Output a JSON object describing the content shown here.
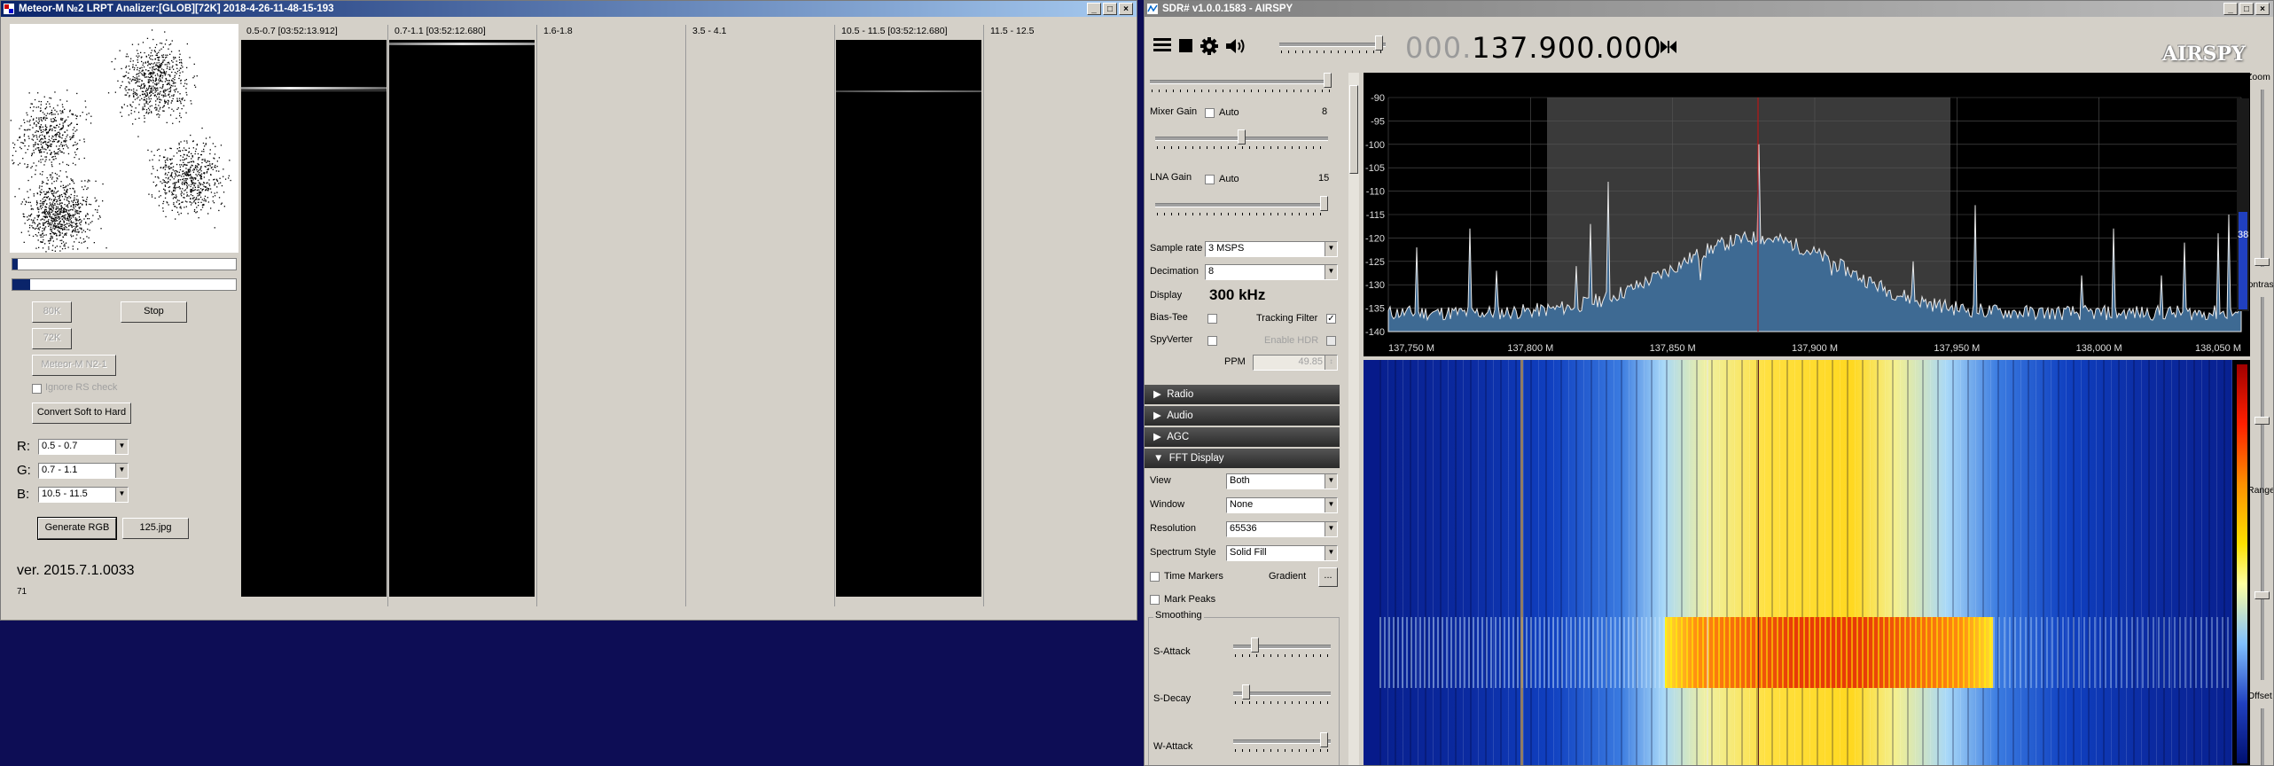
{
  "meteor": {
    "title": "Meteor-M №2 LRPT Analizer:[GLOB][72K] 2018-4-26-11-48-15-193",
    "channel_headers": [
      "0.5-0.7 [03:52:13.912]",
      "0.7-1.1 [03:52:12.680]",
      "1.6-1.8",
      "3.5 - 4.1",
      "10.5 - 11.5 [03:52:12.680]",
      "11.5 - 12.5"
    ],
    "buttons": {
      "btn_80k": "80K",
      "stop": "Stop",
      "btn_72k": "72K",
      "meteor_n21": "Meteor-M N2-1",
      "convert": "Convert Soft to Hard",
      "generate_rgb": "Generate RGB",
      "jpg": "125.jpg"
    },
    "ignore_rs": "Ignore RS check",
    "rgb": {
      "r_label": "R:",
      "r_value": "0.5 - 0.7",
      "g_label": "G:",
      "g_value": "0.7 - 1.1",
      "b_label": "B:",
      "b_value": "10.5 - 11.5"
    },
    "version": "ver. 2015.7.1.0033",
    "count": "71"
  },
  "sdr": {
    "title": "SDR# v1.0.0.1583 - AIRSPY",
    "freq_dim": "000.",
    "freq_main": "137.900.000",
    "logo": "AIRSPY",
    "mixer_gain": {
      "label": "Mixer Gain",
      "auto": "Auto",
      "value": "8",
      "level": 0.5
    },
    "lna_gain": {
      "label": "LNA Gain",
      "auto": "Auto",
      "value": "15",
      "level": 1.0
    },
    "sample_rate": {
      "label": "Sample rate",
      "value": "3 MSPS"
    },
    "decimation": {
      "label": "Decimation",
      "value": "8"
    },
    "display": {
      "label": "Display",
      "value": "300 kHz"
    },
    "bias_tee": "Bias-Tee",
    "tracking_filter": "Tracking Filter",
    "spyverter": "SpyVerter",
    "enable_hdr": "Enable HDR",
    "ppm": {
      "label": "PPM",
      "value": "49.85"
    },
    "sections": [
      "Radio",
      "Audio",
      "AGC",
      "FFT Display"
    ],
    "fft": {
      "view": {
        "label": "View",
        "value": "Both"
      },
      "window": {
        "label": "Window",
        "value": "None"
      },
      "resolution": {
        "label": "Resolution",
        "value": "65536"
      },
      "style": {
        "label": "Spectrum Style",
        "value": "Solid Fill"
      },
      "time_markers": "Time Markers",
      "gradient": "Gradient",
      "gradient_btn": "...",
      "mark_peaks": "Mark Peaks",
      "smoothing": "Smoothing",
      "s_attack": "S-Attack",
      "s_decay": "S-Decay",
      "w_attack": "W-Attack"
    },
    "spectrum": {
      "db_ticks": [
        "-90",
        "-95",
        "-100",
        "-105",
        "-110",
        "-115",
        "-120",
        "-125",
        "-130",
        "-135",
        "-140"
      ],
      "freq_ticks": [
        "137,750 M",
        "137,800 M",
        "137,850 M",
        "137,900 M",
        "137,950 M",
        "138,000 M",
        "138,050 M"
      ]
    },
    "right": {
      "zoom": "Zoom",
      "contrast": "Contrast",
      "range": "Range",
      "offset": "Offset",
      "level_value": "38"
    },
    "colors": {
      "spectrum_fill": "#3e6a93",
      "filter_band": "#3a3a3a",
      "center_line": "#d01010"
    }
  }
}
